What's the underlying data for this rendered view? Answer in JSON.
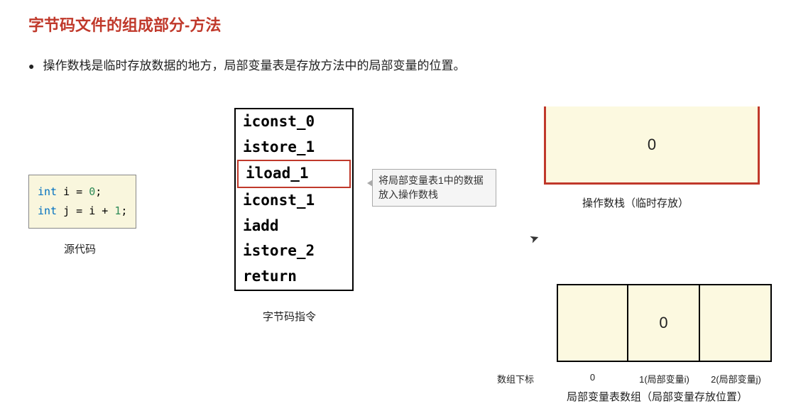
{
  "title": "字节码文件的组成部分-方法",
  "bullet": "操作数栈是临时存放数据的地方，局部变量表是存放方法中的局部变量的位置。",
  "source": {
    "label": "源代码",
    "kw_int": "int",
    "line1_var": "i = ",
    "line1_val": "0",
    "line1_end": ";",
    "line2_var": "j = i + ",
    "line2_val": "1",
    "line2_end": ";"
  },
  "bytecode": {
    "label": "字节码指令",
    "instructions": [
      "iconst_0",
      "istore_1",
      "iload_1",
      "iconst_1",
      "iadd",
      "istore_2",
      "return"
    ],
    "highlight_index": 2
  },
  "tooltip": "将局部变量表1中的数据放入操作数栈",
  "stack": {
    "value": "0",
    "label": "操作数栈（临时存放）"
  },
  "lvt": {
    "cells": [
      "",
      "0",
      ""
    ],
    "index_label": "数组下标",
    "indices": [
      "0",
      "1(局部变量i)",
      "2(局部变量j)"
    ],
    "label": "局部变量表数组（局部变量存放位置）"
  },
  "watermark": ""
}
